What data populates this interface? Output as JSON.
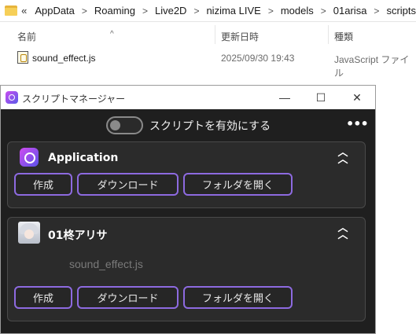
{
  "explorer": {
    "breadcrumb_prefix": "«",
    "breadcrumb": [
      "AppData",
      "Roaming",
      "Live2D",
      "nizima LIVE",
      "models",
      "01arisa",
      "scripts"
    ],
    "columns": {
      "name": "名前",
      "date": "更新日時",
      "type": "種類"
    },
    "sort_indicator": "^",
    "files": [
      {
        "name": "sound_effect.js",
        "date": "2025/09/30 19:43",
        "type": "JavaScript ファイル"
      }
    ]
  },
  "window": {
    "title": "スクリプトマネージャー",
    "controls": {
      "minimize": "—",
      "maximize": "☐",
      "close": "✕"
    }
  },
  "toolbar": {
    "toggle_label": "スクリプトを有効にする",
    "toggle_on": false,
    "more_label": "•••"
  },
  "cards": [
    {
      "title": "Application",
      "icon": "app-logo-icon",
      "collapse_label": "⌃⌃",
      "buttons": {
        "create": "作成",
        "download": "ダウンロード",
        "open_folder": "フォルダを開く"
      }
    },
    {
      "title": "01柊アリサ",
      "icon": "character-avatar",
      "collapse_label": "⌃⌃",
      "script_file": "sound_effect.js",
      "buttons": {
        "create": "作成",
        "download": "ダウンロード",
        "open_folder": "フォルダを開く"
      }
    }
  ],
  "colors": {
    "accent": "#8d6ae0",
    "window_bg": "#1f1f1f",
    "card_bg": "#2b2b2b"
  }
}
